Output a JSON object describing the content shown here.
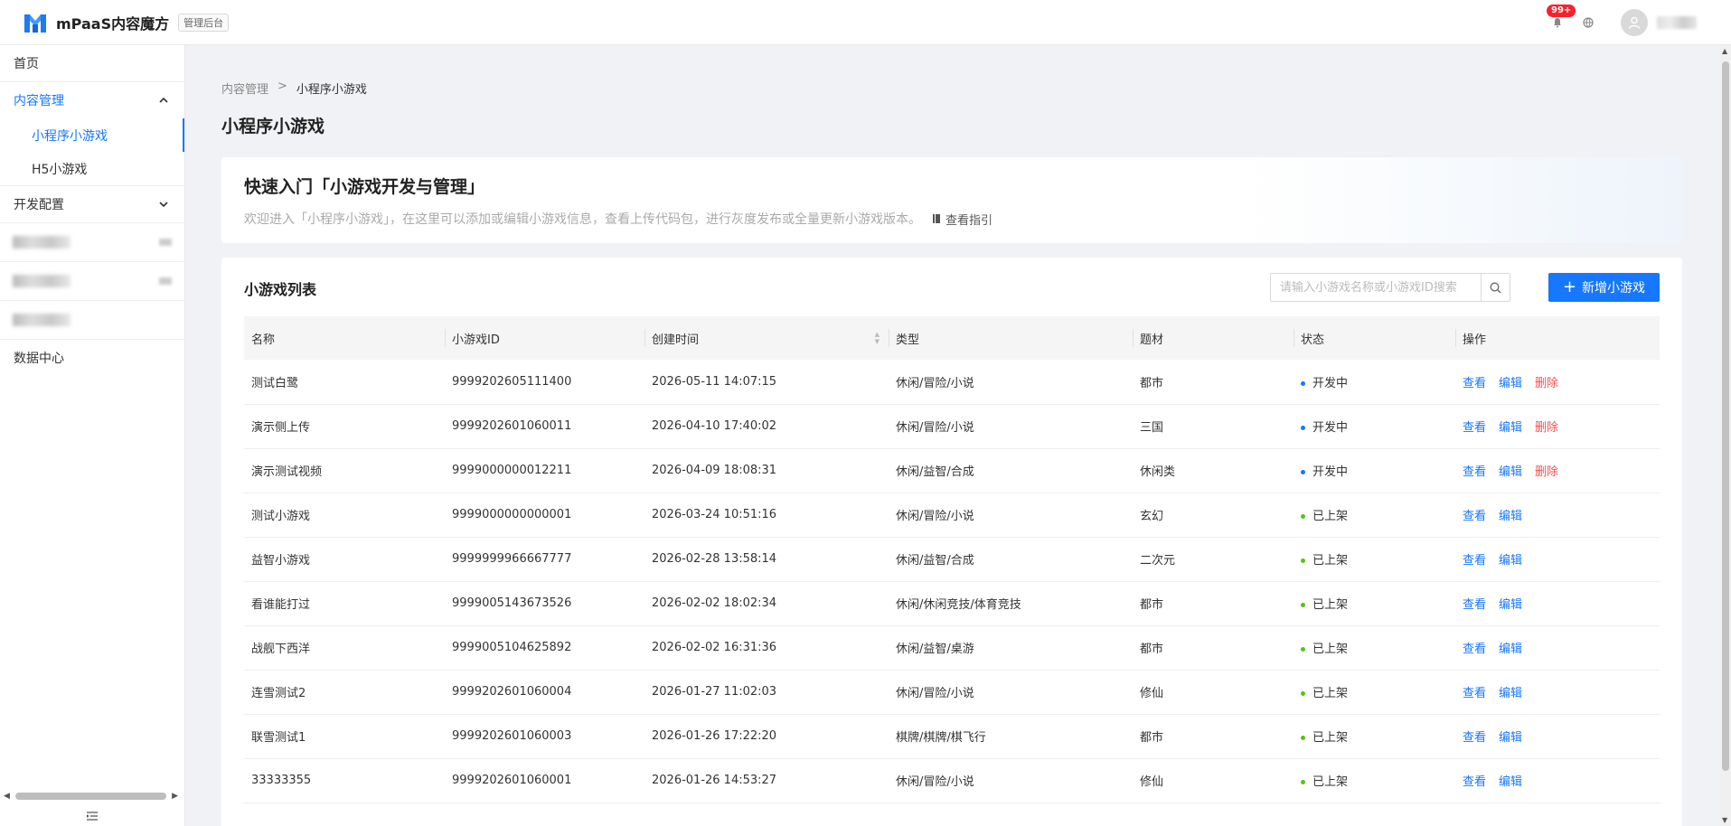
{
  "header": {
    "app_title": "mPaaS内容魔方",
    "admin_badge": "管理后台",
    "notification_count": "99+",
    "accent_color": "#1677ff"
  },
  "sidebar": {
    "home": "首页",
    "content_group": "内容管理",
    "content_items": [
      "小程序小游戏",
      "H5小游戏"
    ],
    "dev_group": "开发配置",
    "data_center": "数据中心"
  },
  "breadcrumb": {
    "parent": "内容管理",
    "separator": ">",
    "current": "小程序小游戏"
  },
  "page_title": "小程序小游戏",
  "intro": {
    "title": "快速入门「小游戏开发与管理」",
    "description": "欢迎进入「小程序小游戏」，在这里可以添加或编辑小游戏信息，查看上传代码包，进行灰度发布或全量更新小游戏版本。",
    "guide_link": "查看指引"
  },
  "list": {
    "title": "小游戏列表",
    "search_placeholder": "请输入小游戏名称或小游戏ID搜索",
    "search_value": "",
    "add_button": "新增小游戏",
    "columns": [
      "名称",
      "小游戏ID",
      "创建时间",
      "类型",
      "题材",
      "状态",
      "操作"
    ],
    "action_labels": {
      "view": "查看",
      "edit": "编辑",
      "delete": "删除"
    },
    "status_colors": {
      "开发中": "#1677ff",
      "已上架": "#52c41a"
    },
    "rows": [
      {
        "name": "测试白鹭",
        "id": "9999202605111400",
        "created": "2026-05-11 14:07:15",
        "type": "休闲/冒险/小说",
        "theme": "都市",
        "status": "开发中",
        "deletable": true
      },
      {
        "name": "演示侧上传",
        "id": "9999202601060011",
        "created": "2026-04-10 17:40:02",
        "type": "休闲/冒险/小说",
        "theme": "三国",
        "status": "开发中",
        "deletable": true
      },
      {
        "name": "演示测试视频",
        "id": "9999000000012211",
        "created": "2026-04-09 18:08:31",
        "type": "休闲/益智/合成",
        "theme": "休闲类",
        "status": "开发中",
        "deletable": true
      },
      {
        "name": "测试小游戏",
        "id": "9999000000000001",
        "created": "2026-03-24 10:51:16",
        "type": "休闲/冒险/小说",
        "theme": "玄幻",
        "status": "已上架",
        "deletable": false
      },
      {
        "name": "益智小游戏",
        "id": "9999999966667777",
        "created": "2026-02-28 13:58:14",
        "type": "休闲/益智/合成",
        "theme": "二次元",
        "status": "已上架",
        "deletable": false
      },
      {
        "name": "看谁能打过",
        "id": "9999005143673526",
        "created": "2026-02-02 18:02:34",
        "type": "休闲/休闲竞技/体育竞技",
        "theme": "都市",
        "status": "已上架",
        "deletable": false
      },
      {
        "name": "战舰下西洋",
        "id": "9999005104625892",
        "created": "2026-02-02 16:31:36",
        "type": "休闲/益智/桌游",
        "theme": "都市",
        "status": "已上架",
        "deletable": false
      },
      {
        "name": "连雪测试2",
        "id": "9999202601060004",
        "created": "2026-01-27 11:02:03",
        "type": "休闲/冒险/小说",
        "theme": "修仙",
        "status": "已上架",
        "deletable": false
      },
      {
        "name": "联雪测试1",
        "id": "9999202601060003",
        "created": "2026-01-26 17:22:20",
        "type": "棋牌/棋牌/棋飞行",
        "theme": "都市",
        "status": "已上架",
        "deletable": false
      },
      {
        "name": "33333355",
        "id": "9999202601060001",
        "created": "2026-01-26 14:53:27",
        "type": "休闲/冒险/小说",
        "theme": "修仙",
        "status": "已上架",
        "deletable": false
      }
    ]
  }
}
